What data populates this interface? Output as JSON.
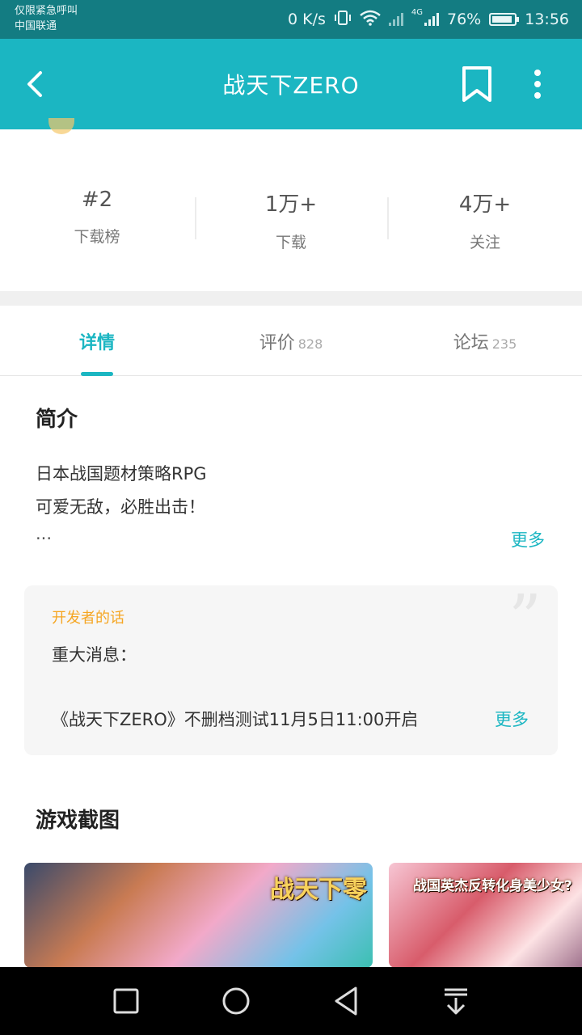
{
  "status_bar": {
    "carrier_line1": "仅限紧急呼叫",
    "carrier_line2": "中国联通",
    "speed": "0 K/s",
    "network": "4G",
    "battery": "76%",
    "time": "13:56"
  },
  "app_bar": {
    "title": "战天下ZERO"
  },
  "stats": [
    {
      "value": "#2",
      "label": "下载榜"
    },
    {
      "value": "1万+",
      "label": "下载"
    },
    {
      "value": "4万+",
      "label": "关注"
    }
  ],
  "tabs": [
    {
      "label": "详情",
      "count": ""
    },
    {
      "label": "评价",
      "count": "828"
    },
    {
      "label": "论坛",
      "count": "235"
    }
  ],
  "intro": {
    "heading": "简介",
    "lines": [
      "日本战国题材策略RPG",
      "可爱无敌，必胜出击！",
      "..."
    ],
    "more": "更多"
  },
  "developer": {
    "label": "开发者的话",
    "line1": "重大消息：",
    "line2": "《战天下ZERO》不删档测试11月5日11:00开启",
    "more": "更多"
  },
  "screenshots": {
    "heading": "游戏截图",
    "shot1_text": "战天下零",
    "shot2_text": "战国英杰反转化身美少女?"
  },
  "colors": {
    "accent": "#1bb6c2",
    "status_bar": "#137c82",
    "dev_label": "#f5a623"
  }
}
